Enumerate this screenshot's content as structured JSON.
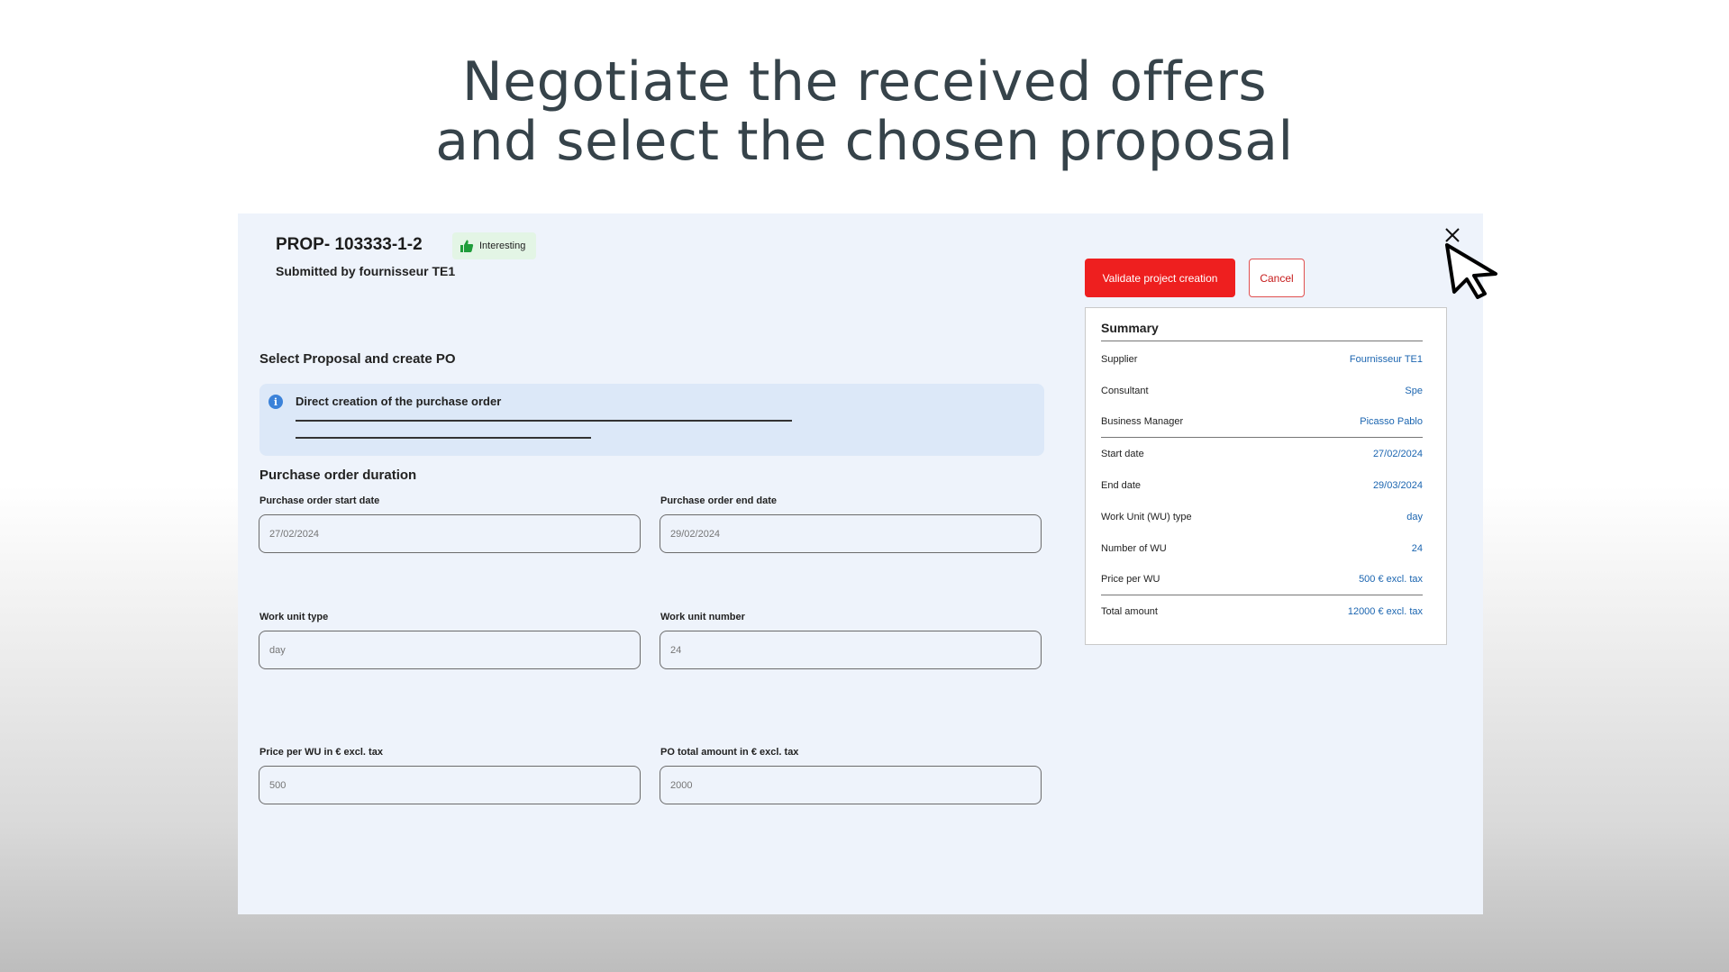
{
  "hero": {
    "line1": "Negotiate the received offers",
    "line2": "and select the chosen proposal"
  },
  "proposal": {
    "id": "PROP- 103333-1-2",
    "badge": "Interesting",
    "submitted_by": "Submitted by fournisseur TE1"
  },
  "form": {
    "section_title": "Select Proposal and create PO",
    "info_text": "Direct creation of the purchase order",
    "duration_title": "Purchase order duration",
    "fields": {
      "start_date": {
        "label": "Purchase order start date",
        "placeholder": "27/02/2024"
      },
      "end_date": {
        "label": "Purchase order end date",
        "placeholder": "29/02/2024"
      },
      "wu_type": {
        "label": "Work unit type",
        "placeholder": "day"
      },
      "wu_number": {
        "label": "Work unit number",
        "placeholder": "24"
      },
      "price_per_wu": {
        "label": "Price per WU in € excl. tax",
        "placeholder": "500"
      },
      "po_total": {
        "label": "PO total amount in € excl. tax",
        "placeholder": "2000"
      }
    }
  },
  "actions": {
    "validate_label": "Validate project creation",
    "cancel_label": "Cancel"
  },
  "summary": {
    "title": "Summary",
    "rows": [
      {
        "key": "Supplier",
        "value": "Fournisseur TE1"
      },
      {
        "key": "Consultant",
        "value": "Spe"
      },
      {
        "key": "Business Manager",
        "value": "Picasso Pablo"
      },
      {
        "key": "Start date",
        "value": "27/02/2024"
      },
      {
        "key": "End date",
        "value": "29/03/2024"
      },
      {
        "key": "Work Unit (WU) type",
        "value": "day"
      },
      {
        "key": "Number of WU",
        "value": "24"
      },
      {
        "key": "Price per WU",
        "value": "500 € excl. tax"
      },
      {
        "key": "Total amount",
        "value": "12000 € excl. tax"
      }
    ]
  },
  "icons": {
    "close": "close-icon",
    "cursor": "cursor-icon",
    "thumb": "thumbs-up-icon",
    "info": "info-icon"
  },
  "colors": {
    "accent_red": "#ee1f1f",
    "link_blue": "#1b65b0",
    "panel_bg": "#eef3fb",
    "badge_green": "#1f9d3a"
  }
}
